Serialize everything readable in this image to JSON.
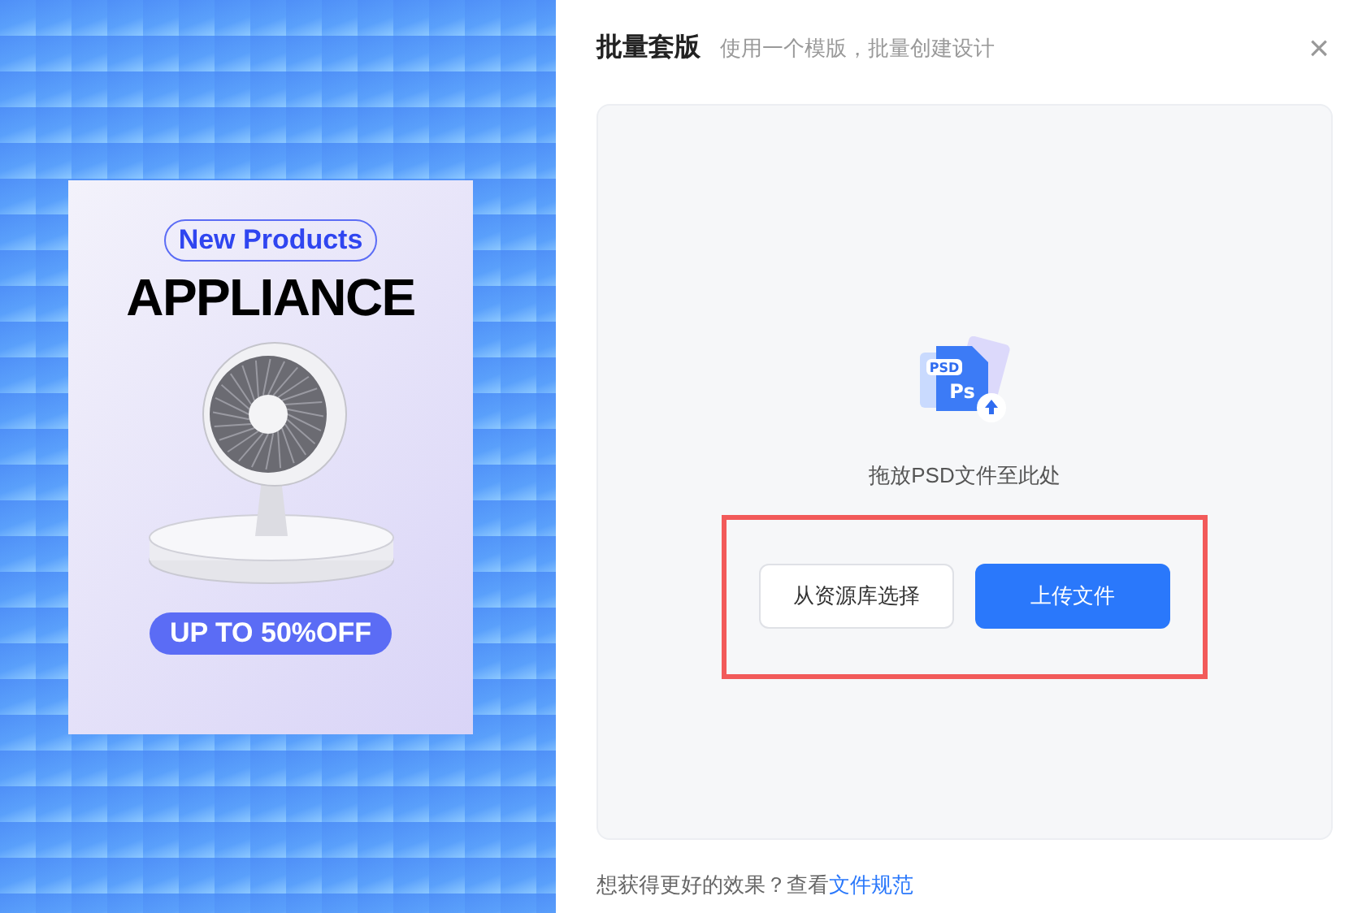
{
  "preview": {
    "badge": "New Products",
    "headline": "APPLIANCE",
    "offer": "UP TO 50%OFF"
  },
  "dialog": {
    "title": "批量套版",
    "subtitle": "使用一个模版，批量创建设计",
    "close": "×"
  },
  "dropzone": {
    "hint": "拖放PSD文件至此处",
    "icon_label": "PSD",
    "icon_letters": "Ps",
    "highlighted": true,
    "buttons": [
      {
        "label": "从资源库选择",
        "kind": "secondary"
      },
      {
        "label": "上传文件",
        "kind": "primary"
      }
    ]
  },
  "footer": {
    "text": "想获得更好的效果？查看",
    "link": "文件规范"
  }
}
